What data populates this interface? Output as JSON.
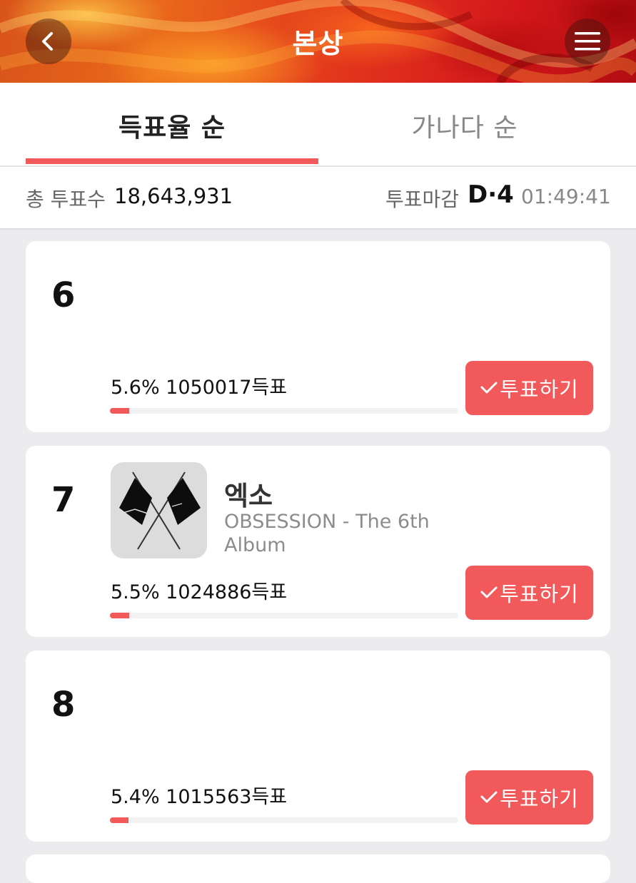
{
  "header": {
    "title": "본상",
    "back_icon": "chevron-left-icon",
    "menu_icon": "hamburger-menu-icon",
    "colors": {
      "from": "#e9681b",
      "to": "#b10d12"
    }
  },
  "tabs": [
    {
      "label": "득표율 순",
      "active": true
    },
    {
      "label": "가나다 순",
      "active": false
    }
  ],
  "summary": {
    "total_votes_label": "총 투표수",
    "total_votes_value": "18,643,931",
    "deadline_label": "투표마감",
    "d_day": "D·4",
    "countdown": "01:49:41"
  },
  "accent_color": "#f2595a",
  "entries": [
    {
      "rank": "6",
      "artist": "",
      "album": "",
      "vote_text": "5.6% 1050017득표",
      "percent": 5.6,
      "vote_button": "투표하기"
    },
    {
      "rank": "7",
      "artist": "엑소",
      "album": "OBSESSION - The 6th Album",
      "album_art_icon": "crossed-flags-icon",
      "vote_text": "5.5% 1024886득표",
      "percent": 5.5,
      "vote_button": "투표하기"
    },
    {
      "rank": "8",
      "artist": "",
      "album": "",
      "vote_text": "5.4% 1015563득표",
      "percent": 5.4,
      "vote_button": "투표하기"
    }
  ]
}
